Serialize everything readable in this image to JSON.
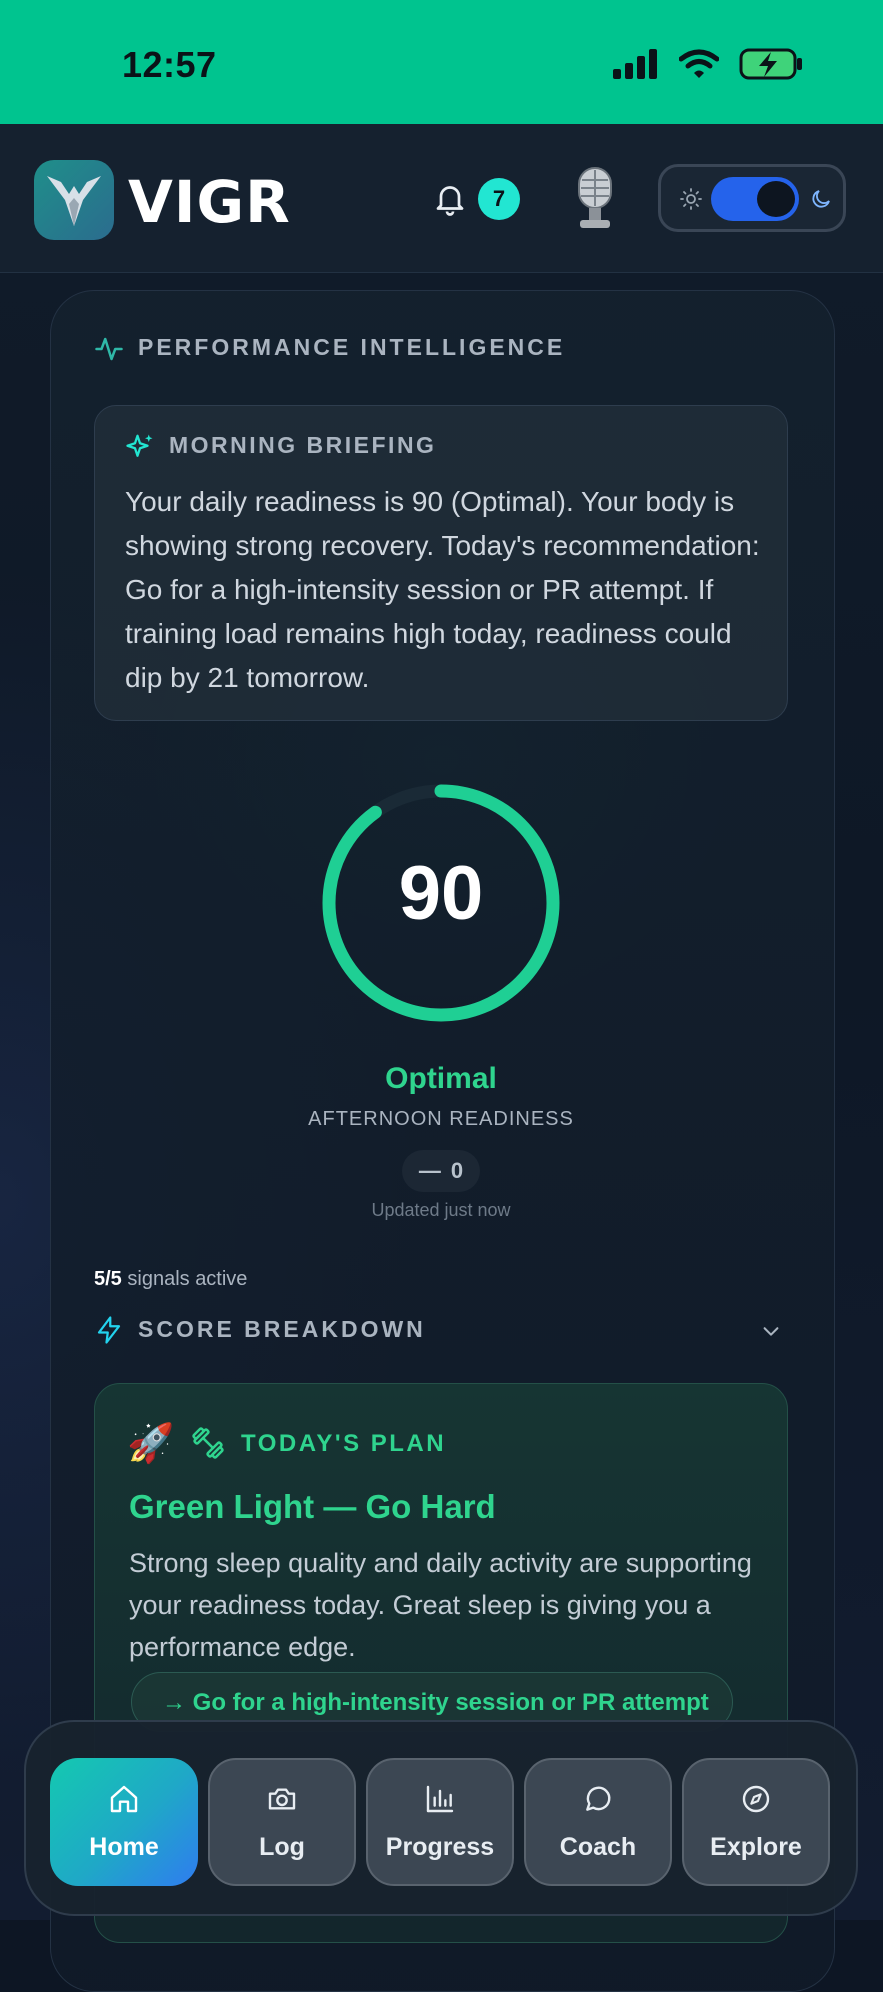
{
  "status_bar": {
    "time": "12:57"
  },
  "header": {
    "app_name": "VIGR",
    "notification_count": "7",
    "theme_mode": "dark"
  },
  "intelligence": {
    "section_title": "PERFORMANCE INTELLIGENCE",
    "briefing_title": "MORNING BRIEFING",
    "briefing_text": "Your daily readiness is 90 (Optimal). Your body is showing strong recovery. Today's recommendation: Go for a high-intensity session or PR attempt. If training load remains high today, readiness could dip by 21 tomorrow.",
    "readiness_score": "90",
    "readiness_fraction": 0.9,
    "status": "Optimal",
    "readiness_label": "AFTERNOON READINESS",
    "delta_symbol": "—",
    "delta_value": "0",
    "updated": "Updated just now",
    "signals_count": "5/5",
    "signals_text": "signals active",
    "breakdown_title": "SCORE BREAKDOWN"
  },
  "plan": {
    "label": "TODAY'S PLAN",
    "headline": "Green Light — Go Hard",
    "text": "Strong sleep quality and daily activity are supporting your readiness today. Great sleep is giving you a performance edge.",
    "action": "→ Go for a high-intensity session or PR attempt"
  },
  "nav": [
    {
      "label": "Home",
      "icon": "home-icon",
      "active": true
    },
    {
      "label": "Log",
      "icon": "camera-icon",
      "active": false
    },
    {
      "label": "Progress",
      "icon": "chart-icon",
      "active": false
    },
    {
      "label": "Coach",
      "icon": "chat-icon",
      "active": false
    },
    {
      "label": "Explore",
      "icon": "compass-icon",
      "active": false
    }
  ],
  "colors": {
    "accent": "#2fd48e",
    "status_bar": "#00c48f",
    "toggle": "#2563eb"
  }
}
